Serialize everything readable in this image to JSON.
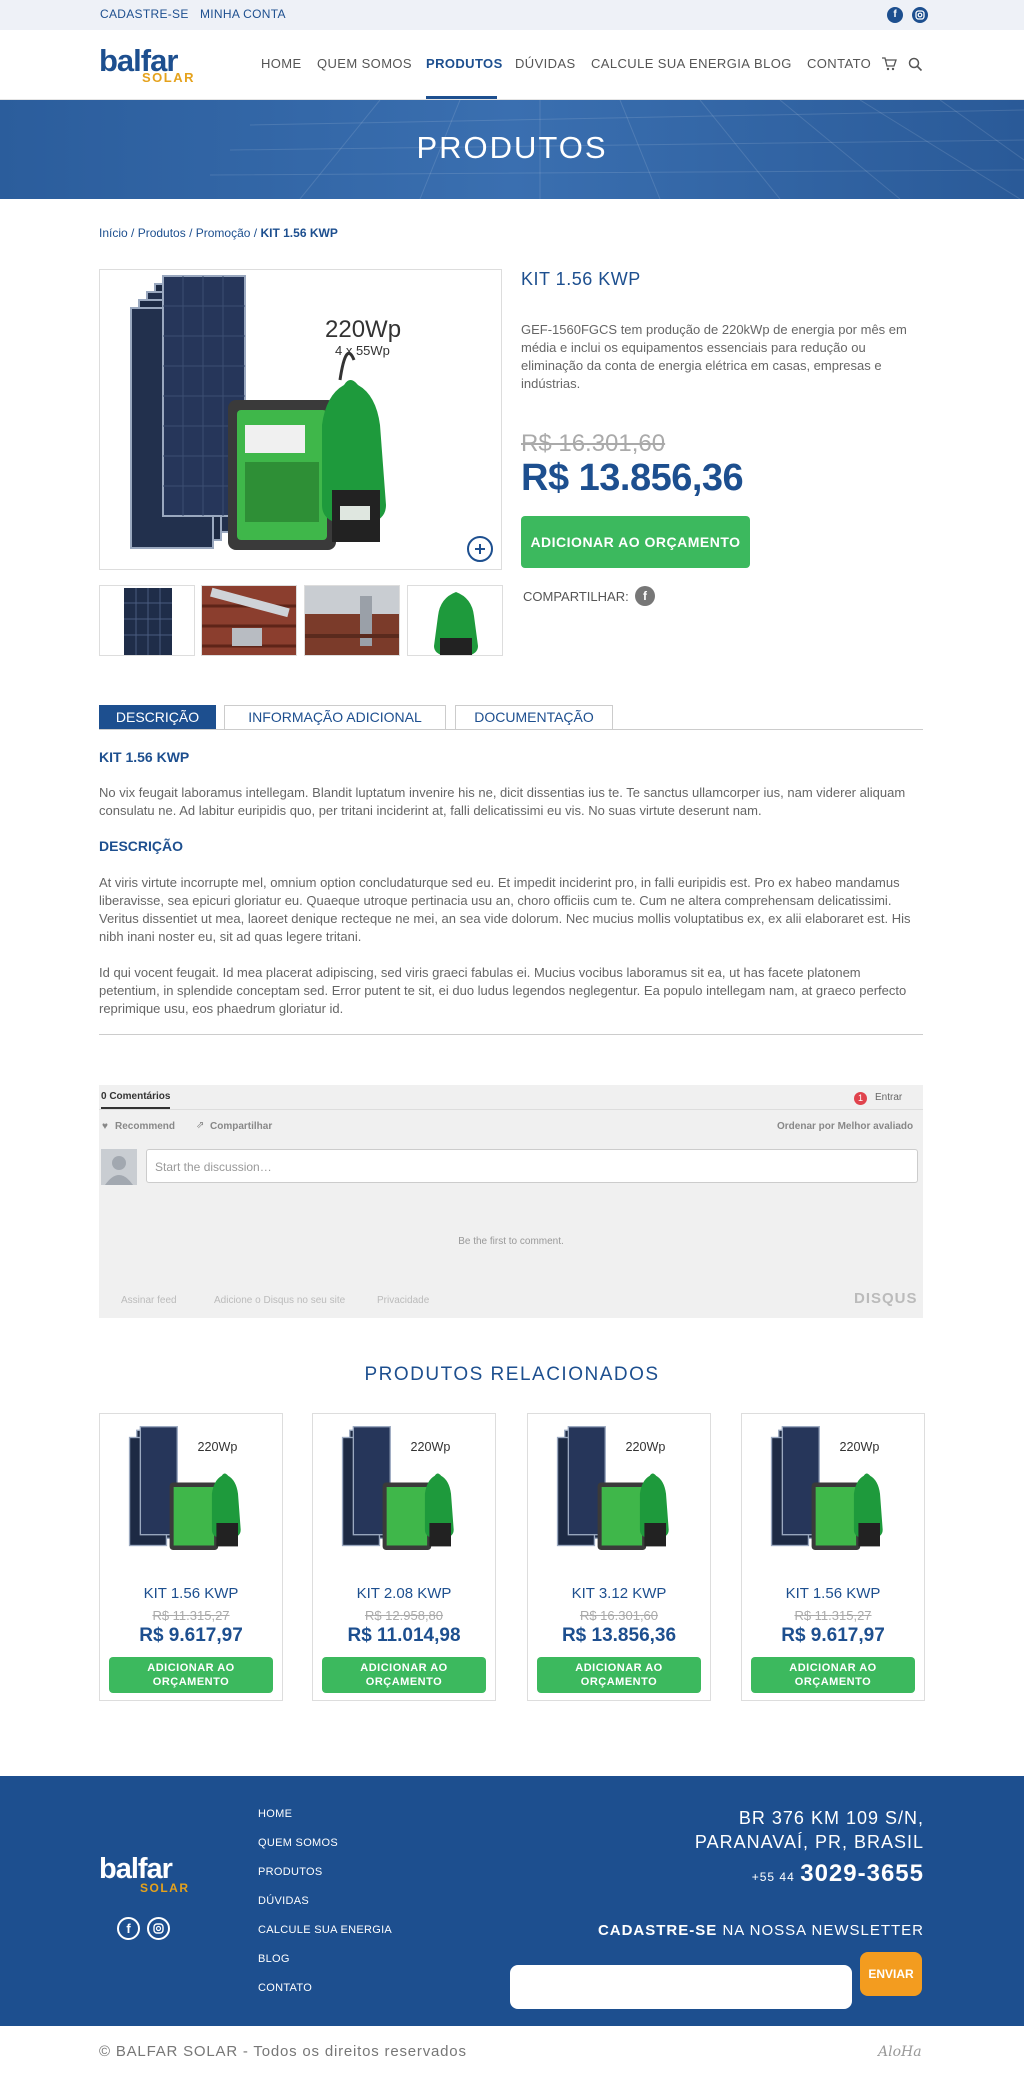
{
  "topbar": {
    "signup": "CADASTRE-SE",
    "account": "MINHA CONTA",
    "social": [
      "facebook-icon",
      "instagram-icon"
    ]
  },
  "brand": {
    "name_main": "balfar",
    "name_sub": "SOLAR",
    "accent": "#1d4f8f",
    "gold": "#e5a21c",
    "green": "#3cb95e"
  },
  "nav": {
    "items": [
      "HOME",
      "QUEM SOMOS",
      "PRODUTOS",
      "DÚVIDAS",
      "CALCULE SUA ENERGIA",
      "BLOG",
      "CONTATO"
    ],
    "active": "PRODUTOS",
    "icons": [
      "cart-icon",
      "search-icon"
    ]
  },
  "banner": {
    "title": "PRODUTOS"
  },
  "breadcrumb": [
    "Início",
    "Produtos",
    "Promoção",
    "KIT 1.56 KWP"
  ],
  "product": {
    "image": {
      "label_big": "220Wp",
      "label_small": "4 x 55Wp"
    },
    "title": "KIT 1.56 KWP",
    "description": "GEF-1560FGCS tem produção de 220kWp de energia por mês em média e inclui os equipamentos essenciais para redução ou eliminação da conta de energia elétrica em casas, empresas e indústrias.",
    "old_price": "R$ 16.301,60",
    "price": "R$ 13.856,36",
    "add_button": "ADICIONAR AO ORÇAMENTO",
    "share_label": "COMPARTILHAR:"
  },
  "tabs": [
    "DESCRIÇÃO",
    "INFORMAÇÃO ADICIONAL",
    "DOCUMENTAÇÃO"
  ],
  "description": {
    "heading1": "KIT 1.56 KWP",
    "para1": "No vix feugait laboramus intellegam. Blandit luptatum invenire his ne, dicit dissentias ius te. Te sanctus ullamcorper ius, nam viderer aliquam consulatu ne. Ad labitur euripidis quo, per tritani inciderint at, falli delicatissimi eu vis. No suas virtute deserunt nam.",
    "heading2": "DESCRIÇÃO",
    "para2": "At viris virtute incorrupte mel, omnium option concludaturque sed eu. Et impedit inciderint pro, in falli euripidis est. Pro ex habeo mandamus liberavisse, sea epicuri gloriatur eu. Quaeque utroque pertinacia usu an, choro officiis cum te. Cum ne altera comprehensam delicatissimi. Veritus dissentiet ut mea, laoreet denique recteque ne mei, an sea vide dolorum. Nec mucius mollis voluptatibus ex, ex alii elaboraret est. His nibh inani noster eu, sit ad quas legere tritani.",
    "para3": "Id qui vocent feugait. Id mea placerat adipiscing, sed viris graeci fabulas ei. Mucius vocibus laboramus sit ea, ut has facete platonem petentium, in splendide conceptam sed. Error putent te sit, ei duo ludus legendos neglegentur. Ea populo intellegam nam, at graeco perfecto reprimique usu, eos phaedrum gloriatur id."
  },
  "comments": {
    "count": "0 Comentários",
    "login": "Entrar",
    "recommend": "Recommend",
    "share": "Compartilhar",
    "sort": "Ordenar por Melhor avaliado",
    "placeholder": "Start the discussion…",
    "empty": "Be the first to comment.",
    "subscribe": "Assinar feed",
    "add": "Adicione o Disqus no seu site",
    "privacy": "Privacidade",
    "brand": "DISQUS",
    "badge": "1"
  },
  "related": {
    "title": "PRODUTOS RELACIONADOS",
    "items": [
      {
        "name": "KIT 1.56 KWP",
        "old": "R$ 11.315,27",
        "price": "R$ 9.617,97",
        "button": "ADICIONAR AO ORÇAMENTO"
      },
      {
        "name": "KIT 2.08 KWP",
        "old": "R$ 12.958,80",
        "price": "R$ 11.014,98",
        "button": "ADICIONAR AO ORÇAMENTO"
      },
      {
        "name": "KIT 3.12 KWP",
        "old": "R$ 16.301,60",
        "price": "R$ 13.856,36",
        "button": "ADICIONAR AO ORÇAMENTO"
      },
      {
        "name": "KIT 1.56 KWP",
        "old": "R$ 11.315,27",
        "price": "R$ 9.617,97",
        "button": "ADICIONAR AO ORÇAMENTO"
      }
    ]
  },
  "footer": {
    "links": [
      "HOME",
      "QUEM SOMOS",
      "PRODUTOS",
      "DÚVIDAS",
      "CALCULE SUA ENERGIA",
      "BLOG",
      "CONTATO"
    ],
    "address1": "BR 376 KM 109 S/N,",
    "address2": "PARANAVAÍ, PR,  BRASIL",
    "phone_prefix": "+55 44",
    "phone": "3029-3655",
    "newsletter_bold": "CADASTRE-SE",
    "newsletter_rest": "NA NOSSA NEWSLETTER",
    "send": "ENVIAR",
    "copyright": "© BALFAR SOLAR - Todos os direitos reservados",
    "credit": "AloHa"
  }
}
